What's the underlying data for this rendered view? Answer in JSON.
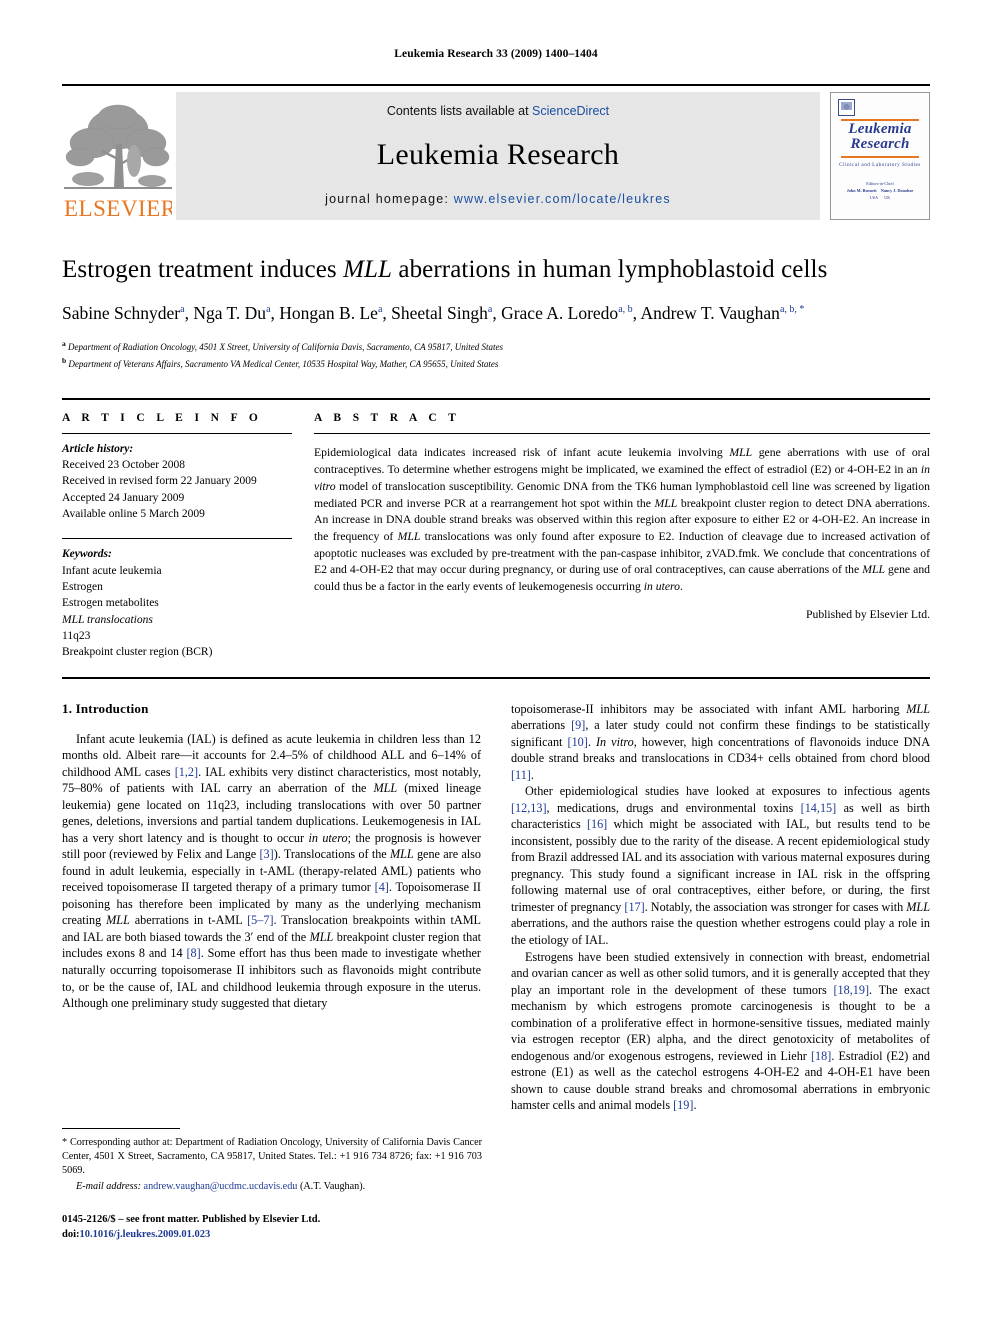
{
  "running_head": "Leukemia Research 33 (2009) 1400–1404",
  "masthead": {
    "contents_prefix": "Contents lists available at ",
    "contents_link": "ScienceDirect",
    "journal_name": "Leukemia Research",
    "homepage_prefix": "journal homepage: ",
    "homepage_url": "www.elsevier.com/locate/leukres",
    "publisher_wordmark": "ELSEVIER",
    "cover": {
      "title_line1": "Leukemia",
      "title_line2": "Research",
      "subtitle": "Clinical and Laboratory Studies",
      "editors_label": "Editors-in-Chief",
      "editor1": "John M. Bennett",
      "editor2": "Nancy J. Donohoe",
      "editor1_loc": "USA",
      "editor2_loc": "UK"
    }
  },
  "article": {
    "title_pre": "Estrogen treatment induces ",
    "title_italic": "MLL",
    "title_post": " aberrations in human lymphoblastoid cells",
    "authors": [
      {
        "name": "Sabine Schnyder",
        "sup": "a"
      },
      {
        "name": "Nga T. Du",
        "sup": "a"
      },
      {
        "name": "Hongan B. Le",
        "sup": "a"
      },
      {
        "name": "Sheetal Singh",
        "sup": "a"
      },
      {
        "name": "Grace A. Loredo",
        "sup": "a, b"
      },
      {
        "name": "Andrew T. Vaughan",
        "sup": "a, b, *"
      }
    ],
    "affiliations": [
      {
        "marker": "a",
        "text": "Department of Radiation Oncology, 4501 X Street, University of California Davis, Sacramento, CA 95817, United States"
      },
      {
        "marker": "b",
        "text": "Department of Veterans Affairs, Sacramento VA Medical Center, 10535 Hospital Way, Mather, CA 95655, United States"
      }
    ]
  },
  "article_info": {
    "heading": "A R T I C L E  I N F O",
    "history_label": "Article history:",
    "history": [
      "Received 23 October 2008",
      "Received in revised form 22 January 2009",
      "Accepted 24 January 2009",
      "Available online 5 March 2009"
    ],
    "keywords_label": "Keywords:",
    "keywords": [
      "Infant acute leukemia",
      "Estrogen",
      "Estrogen metabolites",
      "MLL translocations",
      "11q23",
      "Breakpoint cluster region (BCR)"
    ]
  },
  "abstract": {
    "heading": "A B S T R A C T",
    "paragraphs": [
      "Epidemiological data indicates increased risk of infant acute leukemia involving MLL gene aberrations with use of oral contraceptives. To determine whether estrogens might be implicated, we examined the effect of estradiol (E2) or 4-OH-E2 in an in vitro model of translocation susceptibility. Genomic DNA from the TK6 human lymphoblastoid cell line was screened by ligation mediated PCR and inverse PCR at a rearrangement hot spot within the MLL breakpoint cluster region to detect DNA aberrations. An increase in DNA double strand breaks was observed within this region after exposure to either E2 or 4-OH-E2. An increase in the frequency of MLL translocations was only found after exposure to E2. Induction of cleavage due to increased activation of apoptotic nucleases was excluded by pre-treatment with the pan-caspase inhibitor, zVAD.fmk. We conclude that concentrations of E2 and 4-OH-E2 that may occur during pregnancy, or during use of oral contraceptives, can cause aberrations of the MLL gene and could thus be a factor in the early events of leukemogenesis occurring in utero."
    ],
    "published_by": "Published by Elsevier Ltd."
  },
  "introduction": {
    "heading": "1. Introduction",
    "left_paragraphs": [
      "Infant acute leukemia (IAL) is defined as acute leukemia in children less than 12 months old. Albeit rare—it accounts for 2.4–5% of childhood ALL and 6–14% of childhood AML cases [1,2]. IAL exhibits very distinct characteristics, most notably, 75–80% of patients with IAL carry an aberration of the MLL (mixed lineage leukemia) gene located on 11q23, including translocations with over 50 partner genes, deletions, inversions and partial tandem duplications. Leukemogenesis in IAL has a very short latency and is thought to occur in utero; the prognosis is however still poor (reviewed by Felix and Lange [3]). Translocations of the MLL gene are also found in adult leukemia, especially in t-AML (therapy-related AML) patients who received topoisomerase II targeted therapy of a primary tumor [4]. Topoisomerase II poisoning has therefore been implicated by many as the underlying mechanism creating MLL aberrations in t-AML [5–7]. Translocation breakpoints within tAML and IAL are both biased towards the 3′ end of the MLL breakpoint cluster region that includes exons 8 and 14 [8]. Some effort has thus been made to investigate whether naturally occurring topoisomerase II inhibitors such as flavonoids might contribute to, or be the cause of, IAL and childhood leukemia through exposure in the uterus. Although one preliminary study suggested that dietary"
    ],
    "right_paragraphs": [
      "topoisomerase-II inhibitors may be associated with infant AML harboring MLL aberrations [9], a later study could not confirm these findings to be statistically significant [10]. In vitro, however, high concentrations of flavonoids induce DNA double strand breaks and translocations in CD34+ cells obtained from chord blood [11].",
      "Other epidemiological studies have looked at exposures to infectious agents [12,13], medications, drugs and environmental toxins [14,15] as well as birth characteristics [16] which might be associated with IAL, but results tend to be inconsistent, possibly due to the rarity of the disease. A recent epidemiological study from Brazil addressed IAL and its association with various maternal exposures during pregnancy. This study found a significant increase in IAL risk in the offspring following maternal use of oral contraceptives, either before, or during, the first trimester of pregnancy [17]. Notably, the association was stronger for cases with MLL aberrations, and the authors raise the question whether estrogens could play a role in the etiology of IAL.",
      "Estrogens have been studied extensively in connection with breast, endometrial and ovarian cancer as well as other solid tumors, and it is generally accepted that they play an important role in the development of these tumors [18,19]. The exact mechanism by which estrogens promote carcinogenesis is thought to be a combination of a proliferative effect in hormone-sensitive tissues, mediated mainly via estrogen receptor (ER) alpha, and the direct genotoxicity of metabolites of endogenous and/or exogenous estrogens, reviewed in Liehr [18]. Estradiol (E2) and estrone (E1) as well as the catechol estrogens 4-OH-E2 and 4-OH-E1 have been shown to cause double strand breaks and chromosomal aberrations in embryonic hamster cells and animal models [19]."
    ]
  },
  "footnote": {
    "corresponding": "* Corresponding author at: Department of Radiation Oncology, University of California Davis Cancer Center, 4501 X Street, Sacramento, CA 95817, United States. Tel.: +1 916 734 8726; fax: +1 916 703 5069.",
    "email_label": "E-mail address:",
    "email": "andrew.vaughan@ucdmc.ucdavis.edu",
    "email_owner": "(A.T. Vaughan)."
  },
  "copyright": {
    "issn_line": "0145-2126/$ – see front matter. Published by Elsevier Ltd.",
    "doi_label": "doi:",
    "doi": "10.1016/j.leukres.2009.01.023"
  },
  "colors": {
    "link_blue": "#1a4fa0",
    "citation_blue": "#1f3a93",
    "elsevier_orange": "#E87722",
    "masthead_grey": "#e6e6e6",
    "cover_blue": "#2b3b8f"
  }
}
